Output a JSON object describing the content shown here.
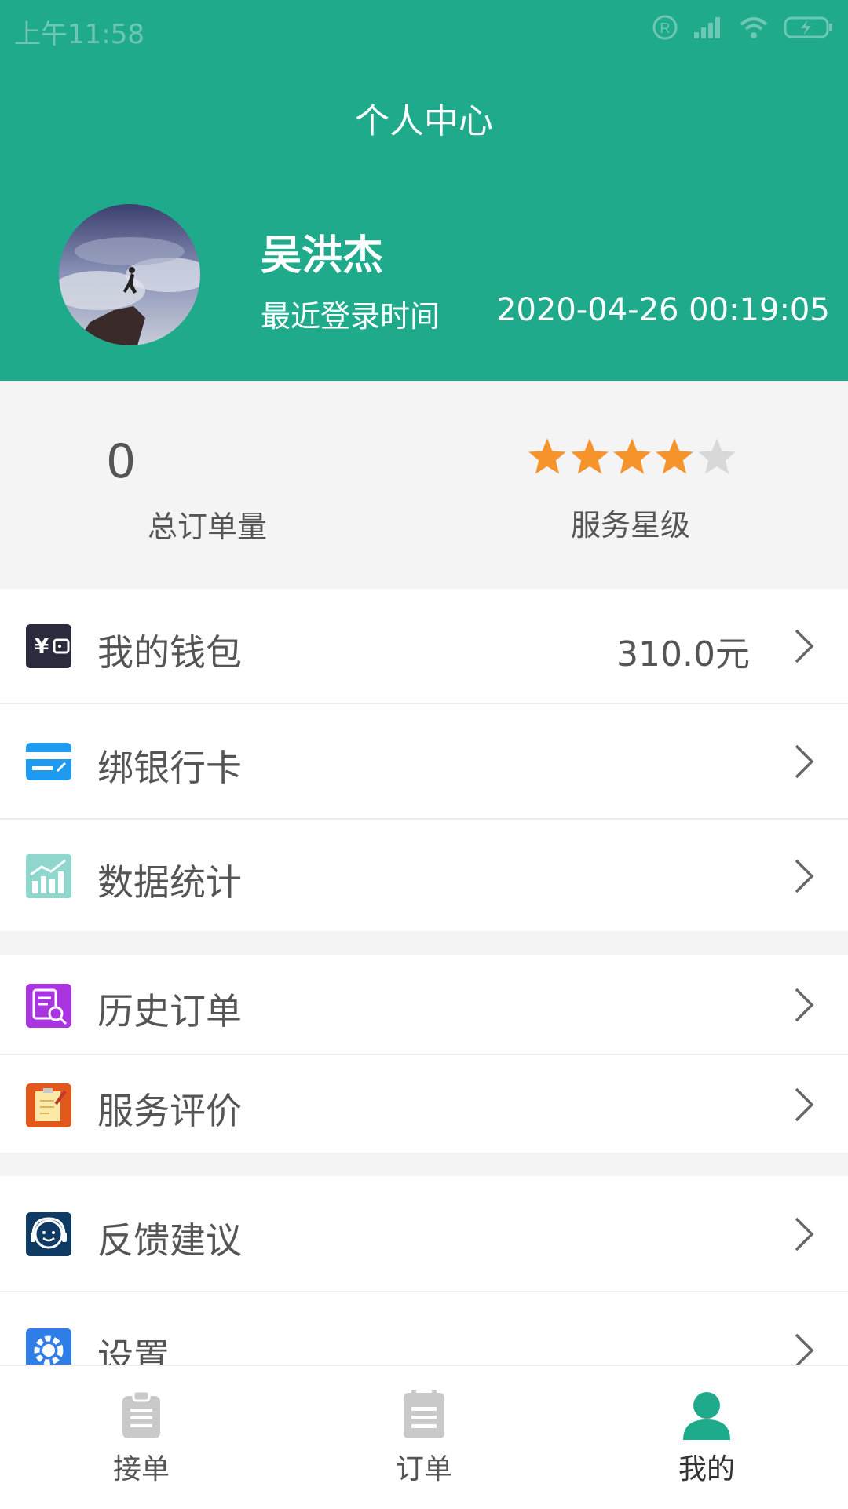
{
  "status_bar": {
    "time": "上午11:58"
  },
  "header": {
    "title": "个人中心",
    "user_name": "吴洪杰",
    "login_label": "最近登录时间",
    "login_time": "2020-04-26 00:19:05"
  },
  "stats": {
    "total_orders_value": "0",
    "total_orders_label": "总订单量",
    "service_rating_label": "服务星级",
    "service_rating_stars": 4,
    "service_rating_max": 5
  },
  "menu": {
    "wallet": {
      "label": "我的钱包",
      "value": "310.0元",
      "icon": "wallet-icon"
    },
    "bank_card": {
      "label": "绑银行卡",
      "icon": "bank-card-icon"
    },
    "statistics": {
      "label": "数据统计",
      "icon": "chart-icon"
    },
    "history": {
      "label": "历史订单",
      "icon": "history-order-icon"
    },
    "review": {
      "label": "服务评价",
      "icon": "review-icon"
    },
    "feedback": {
      "label": "反馈建议",
      "icon": "feedback-icon"
    },
    "settings": {
      "label": "设置",
      "icon": "settings-icon"
    }
  },
  "bottom_nav": {
    "items": [
      {
        "label": "接单",
        "icon": "clipboard-icon",
        "active": false
      },
      {
        "label": "订单",
        "icon": "list-icon",
        "active": false
      },
      {
        "label": "我的",
        "icon": "person-icon",
        "active": true
      }
    ]
  },
  "colors": {
    "primary": "#1faa8c",
    "star_filled": "#f7932b",
    "star_empty": "#d8d8d8",
    "text": "#555555"
  }
}
